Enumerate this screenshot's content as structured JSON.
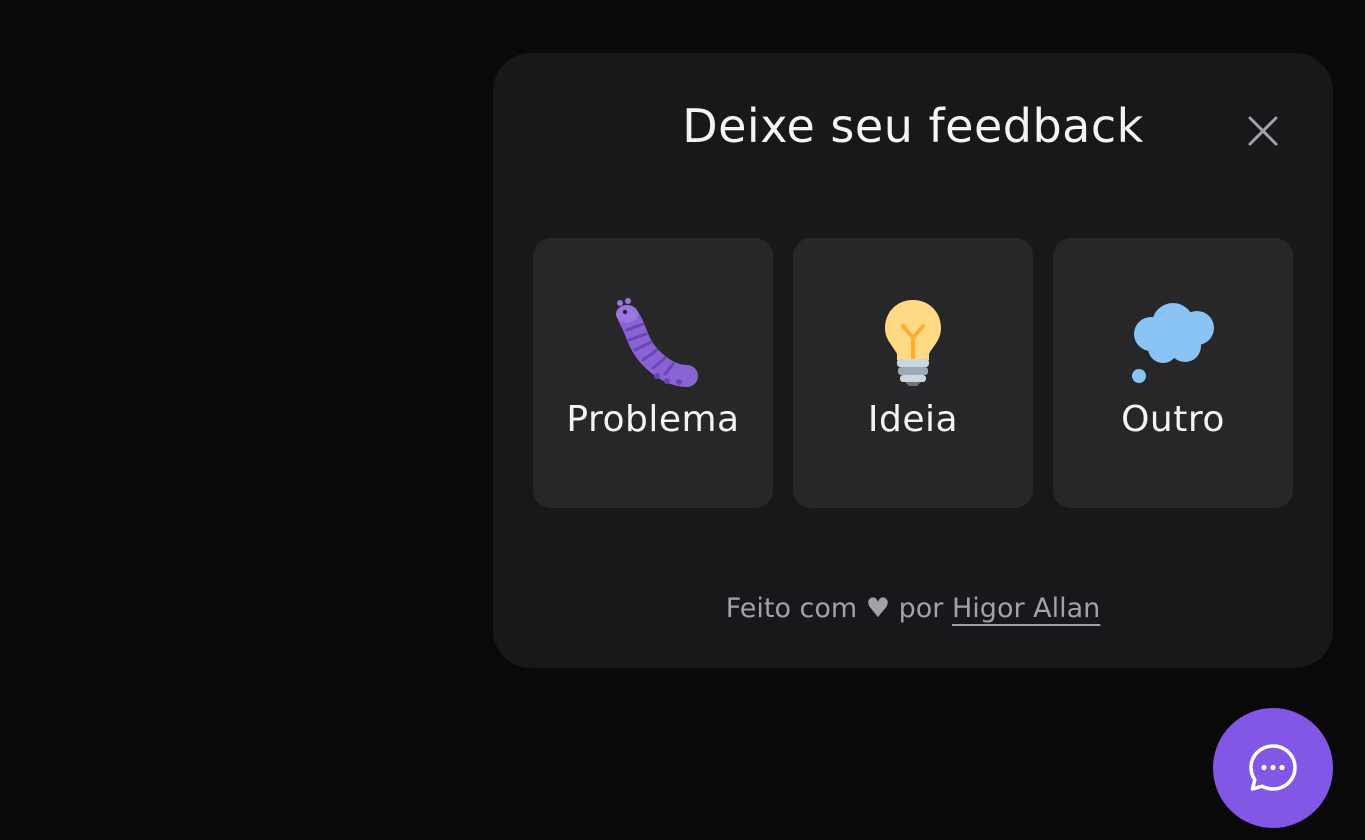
{
  "widget": {
    "title": "Deixe seu feedback",
    "close_icon": "close-icon"
  },
  "options": [
    {
      "label": "Problema",
      "icon": "caterpillar-bug-icon"
    },
    {
      "label": "Ideia",
      "icon": "lightbulb-icon"
    },
    {
      "label": "Outro",
      "icon": "thought-balloon-icon"
    }
  ],
  "footer": {
    "prefix": "Feito com",
    "heart": "♥",
    "middle": "por",
    "author": "Higor Allan"
  },
  "fab": {
    "icon": "chat-bubble-icon"
  },
  "colors": {
    "background": "#09090a",
    "surface": "#18181b",
    "card": "#27272a",
    "brand": "#8257e5"
  }
}
